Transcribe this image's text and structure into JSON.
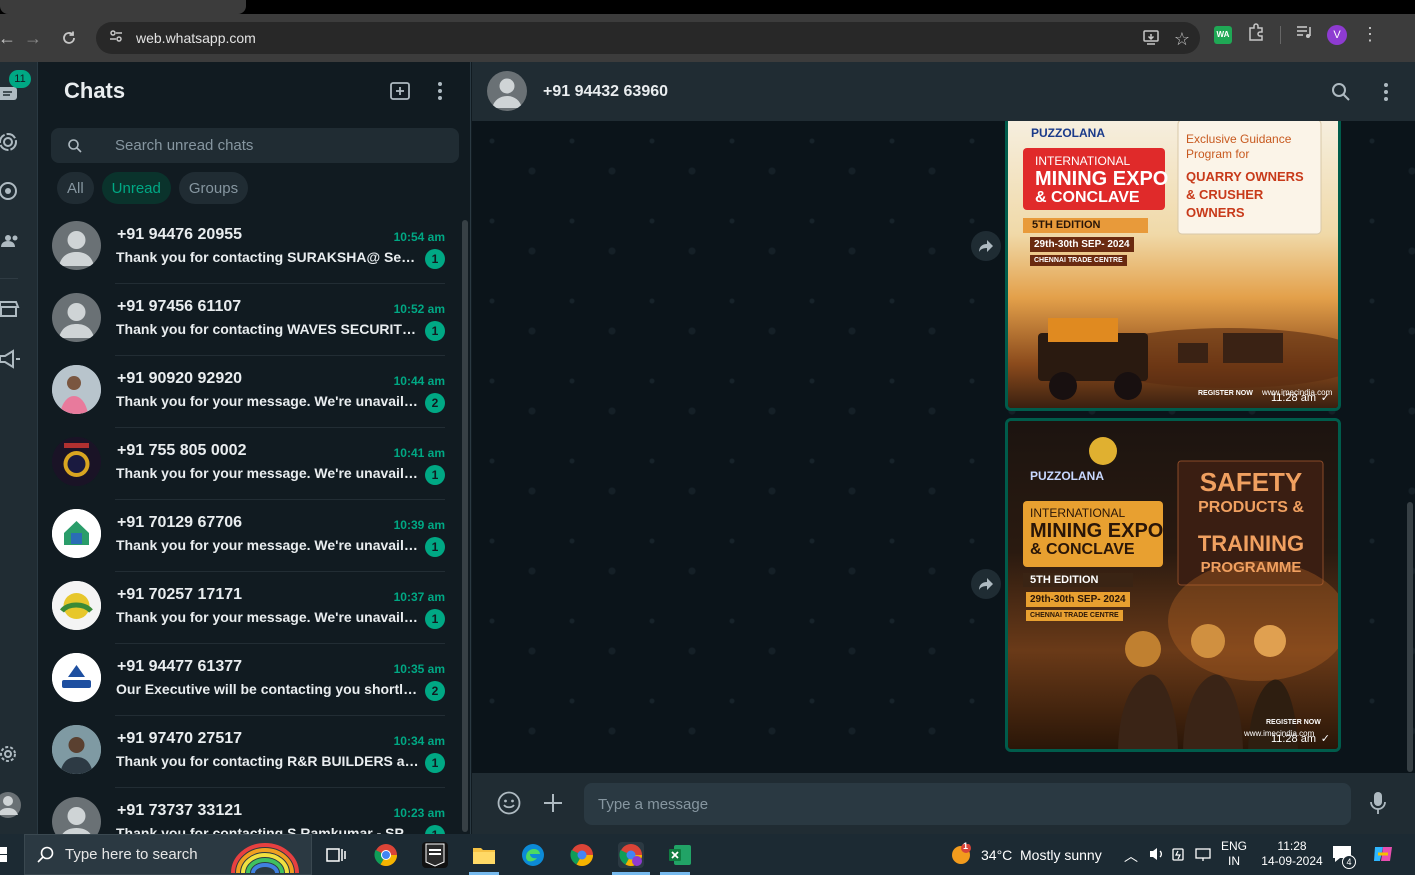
{
  "browser": {
    "url": "web.whatsapp.com",
    "profile_initial": "V",
    "extension_label": "WA"
  },
  "rail": {
    "unread_badge": "11"
  },
  "sidebar": {
    "title": "Chats",
    "search_placeholder": "Search unread chats",
    "filters": [
      "All",
      "Unread",
      "Groups"
    ],
    "active_filter": "Unread",
    "chats": [
      {
        "name": "+91 94476 20955",
        "time": "10:54 am",
        "preview": "Thank you for contacting SURAKSHA@ Security Services",
        "unread": "1"
      },
      {
        "name": "+91 97456 61107",
        "time": "10:52 am",
        "preview": "Thank you for contacting WAVES SECURITY SERVICES",
        "unread": "1"
      },
      {
        "name": "+91 90920 92920",
        "time": "10:44 am",
        "preview": "Thank you for your message. We're unavailable right now",
        "unread": "2"
      },
      {
        "name": "+91 755 805 0002",
        "time": "10:41 am",
        "preview": "Thank you for your message. We're unavailable right now",
        "unread": "1"
      },
      {
        "name": "+91 70129 67706",
        "time": "10:39 am",
        "preview": "Thank you for your message. We're unavailable right now",
        "unread": "1"
      },
      {
        "name": "+91 70257 17171",
        "time": "10:37 am",
        "preview": "Thank you for your message. We're unavailable right now",
        "unread": "1"
      },
      {
        "name": "+91 94477 61377",
        "time": "10:35 am",
        "preview": "Our Executive will be contacting you shortly.. Thank you",
        "unread": "2"
      },
      {
        "name": "+91 97470 27517",
        "time": "10:34 am",
        "preview": "Thank you for contacting R&R BUILDERS  and DEVELOPERS",
        "unread": "1"
      },
      {
        "name": "+91 73737 33121",
        "time": "10:23 am",
        "preview": "Thank you for contacting S Ramkumar - SPLS",
        "unread": "1"
      }
    ]
  },
  "conversation": {
    "contact": "+91 94432 63960",
    "composer_placeholder": "Type a message",
    "messages": [
      {
        "brand": "PUZZOLANA",
        "event_top": "INTERNATIONAL",
        "event_main": "MINING EXPO",
        "event_sub": "& CONCLAVE",
        "edition": "5TH EDITION",
        "dates": "29th-30th SEP- 2024",
        "venue": "CHENNAI TRADE CENTRE",
        "side_small": "Exclusive Guidance Program for",
        "side_big": "QUARRY OWNERS & CRUSHER OWNERS",
        "register": "REGISTER NOW",
        "site": "www.imecindia.com",
        "time": "11:28 am"
      },
      {
        "brand": "PUZZOLANA",
        "event_top": "INTERNATIONAL",
        "event_main": "MINING EXPO",
        "event_sub": "& CONCLAVE",
        "edition": "5TH EDITION",
        "dates": "29th-30th SEP- 2024",
        "venue": "CHENNAI TRADE CENTRE",
        "side_big1": "SAFETY",
        "side_big2": "PRODUCTS &",
        "side_big3": "TRAINING",
        "side_big4": "PROGRAMME",
        "register": "REGISTER NOW",
        "site": "www.imecindia.com",
        "time": "11:28 am"
      }
    ]
  },
  "taskbar": {
    "search_placeholder": "Type here to search",
    "weather_temp": "34°C",
    "weather_text": "Mostly sunny",
    "weather_badge": "1",
    "lang_top": "ENG",
    "lang_bottom": "IN",
    "clock_time": "11:28",
    "clock_date": "14-09-2024",
    "notification_count": "4"
  }
}
